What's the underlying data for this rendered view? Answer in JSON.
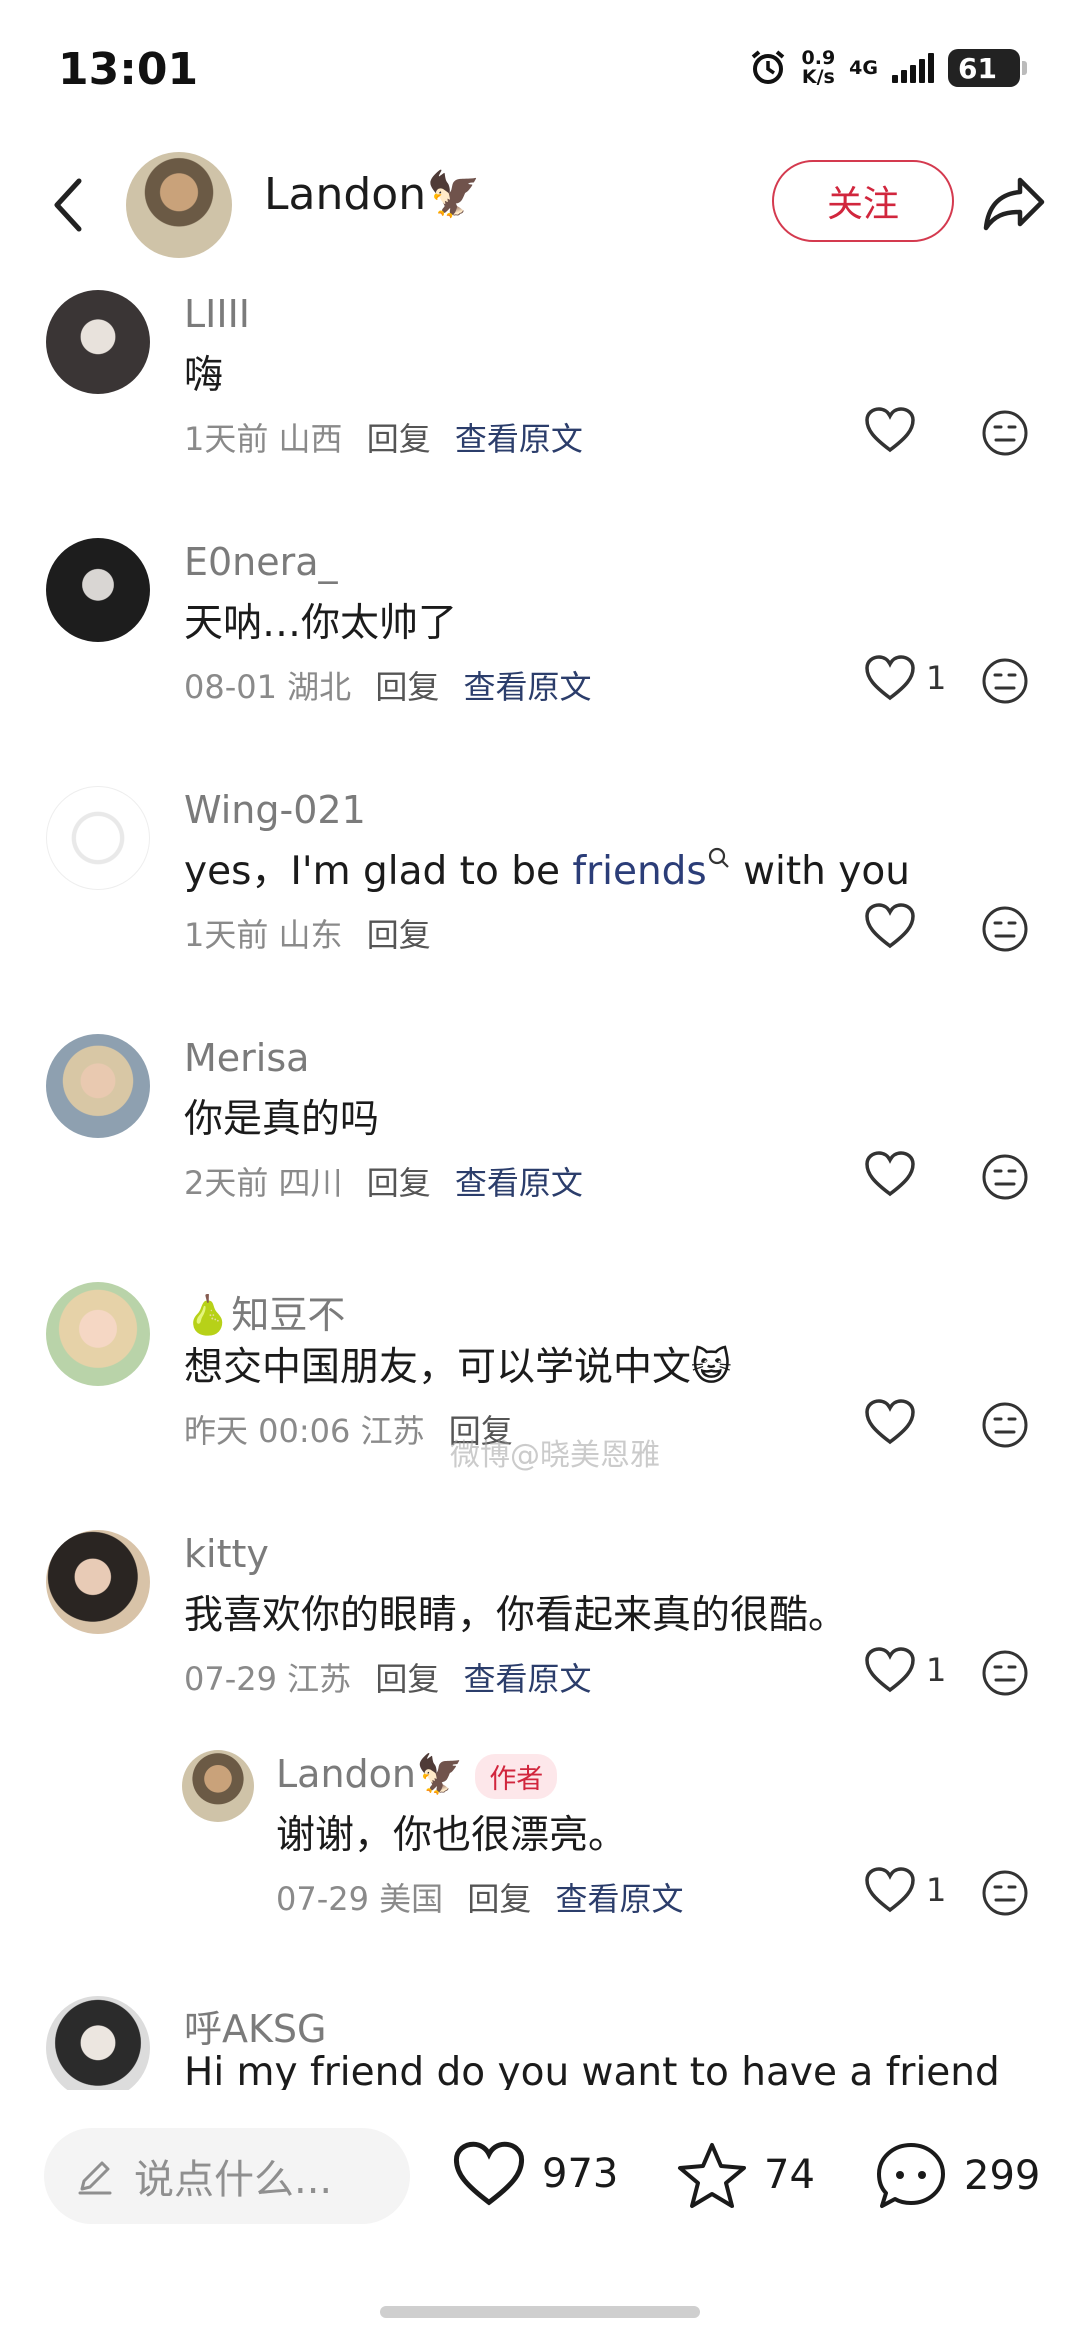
{
  "status": {
    "time": "13:01",
    "net_speed_top": "0.9",
    "net_speed_bottom": "K/s",
    "network": "4G",
    "battery": "61"
  },
  "header": {
    "name": "Landon🦅",
    "follow_label": "关注"
  },
  "comments": [
    {
      "name": "LIIII",
      "text": "嗨",
      "date": "1天前",
      "location": "山西",
      "reply": "回复",
      "view_original": "查看原文",
      "likes": ""
    },
    {
      "name": "E0nera_",
      "text": "天呐…你太帅了",
      "date": "08-01",
      "location": "湖北",
      "reply": "回复",
      "view_original": "查看原文",
      "likes": "1"
    },
    {
      "name": "Wing-021",
      "text_before": "yes，I'm glad to be ",
      "text_link": "friends",
      "text_after": " with you",
      "date": "1天前",
      "location": "山东",
      "reply": "回复",
      "likes": ""
    },
    {
      "name": "Merisa",
      "text": "你是真的吗",
      "date": "2天前",
      "location": "四川",
      "reply": "回复",
      "view_original": "查看原文",
      "likes": ""
    },
    {
      "name": "🍐知豆不",
      "text": "想交中国朋友，可以学说中文😺",
      "date": "昨天 00:06",
      "location": "江苏",
      "reply": "回复",
      "likes": ""
    },
    {
      "name": "kitty",
      "text": "我喜欢你的眼睛，你看起来真的很酷。",
      "date": "07-29",
      "location": "江苏",
      "reply": "回复",
      "view_original": "查看原文",
      "likes": "1"
    },
    {
      "name": "Landon🦅",
      "author_tag": "作者",
      "text": "谢谢，你也很漂亮。",
      "date": "07-29",
      "location": "美国",
      "reply": "回复",
      "view_original": "查看原文",
      "likes": "1"
    },
    {
      "name": "呼AKSG",
      "text": "Hi my friend do you want to have a friend"
    }
  ],
  "watermark": "微博@晓美恩雅",
  "bottom": {
    "input_placeholder": "说点什么...",
    "likes": "973",
    "stars": "74",
    "comments": "299"
  }
}
